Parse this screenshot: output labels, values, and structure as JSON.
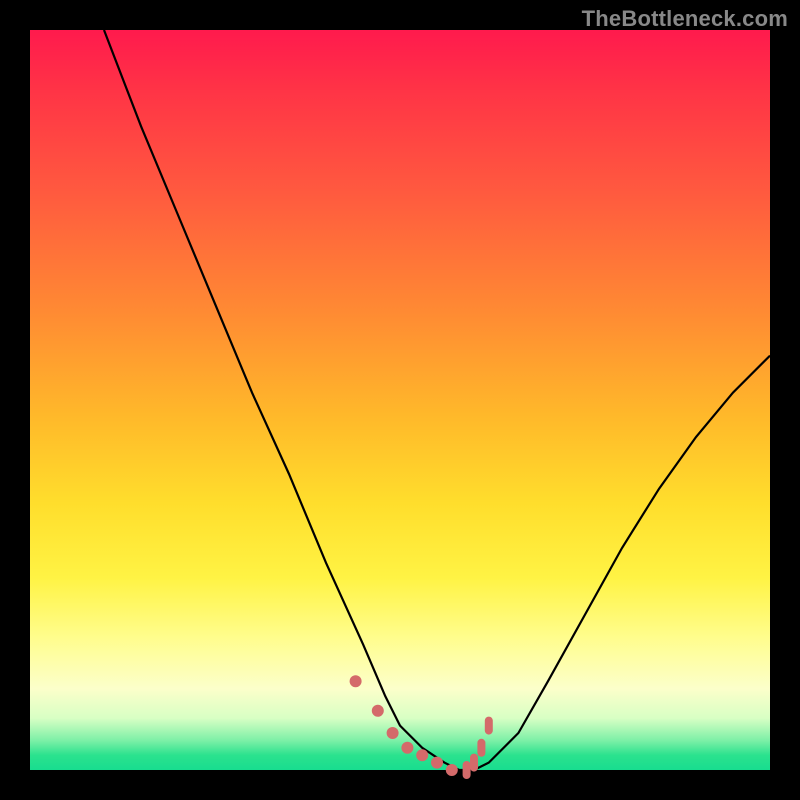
{
  "watermark": "TheBottleneck.com",
  "colors": {
    "frame": "#000000",
    "gradient_top": "#ff1a4d",
    "gradient_bottom": "#18dd8f",
    "curve": "#000000",
    "dots": "#d46a6a"
  },
  "chart_data": {
    "type": "line",
    "title": "",
    "xlabel": "",
    "ylabel": "",
    "xlim": [
      0,
      100
    ],
    "ylim": [
      0,
      100
    ],
    "grid": false,
    "legend": false,
    "background": "vertical-gradient red→yellow→green",
    "series": [
      {
        "name": "curve",
        "x": [
          10,
          15,
          20,
          25,
          30,
          35,
          40,
          45,
          48,
          50,
          53,
          56,
          58,
          60,
          62,
          66,
          70,
          75,
          80,
          85,
          90,
          95,
          100
        ],
        "values": [
          100,
          87,
          75,
          63,
          51,
          40,
          28,
          17,
          10,
          6,
          3,
          1,
          0,
          0,
          1,
          5,
          12,
          21,
          30,
          38,
          45,
          51,
          56
        ]
      }
    ],
    "highlight_points": {
      "name": "near-minimum-markers",
      "color": "#d46a6a",
      "x": [
        44,
        47,
        49,
        51,
        53,
        55,
        57,
        59,
        60,
        61,
        62
      ],
      "value": [
        12,
        8,
        5,
        3,
        2,
        1,
        0,
        0,
        1,
        3,
        6
      ]
    }
  }
}
